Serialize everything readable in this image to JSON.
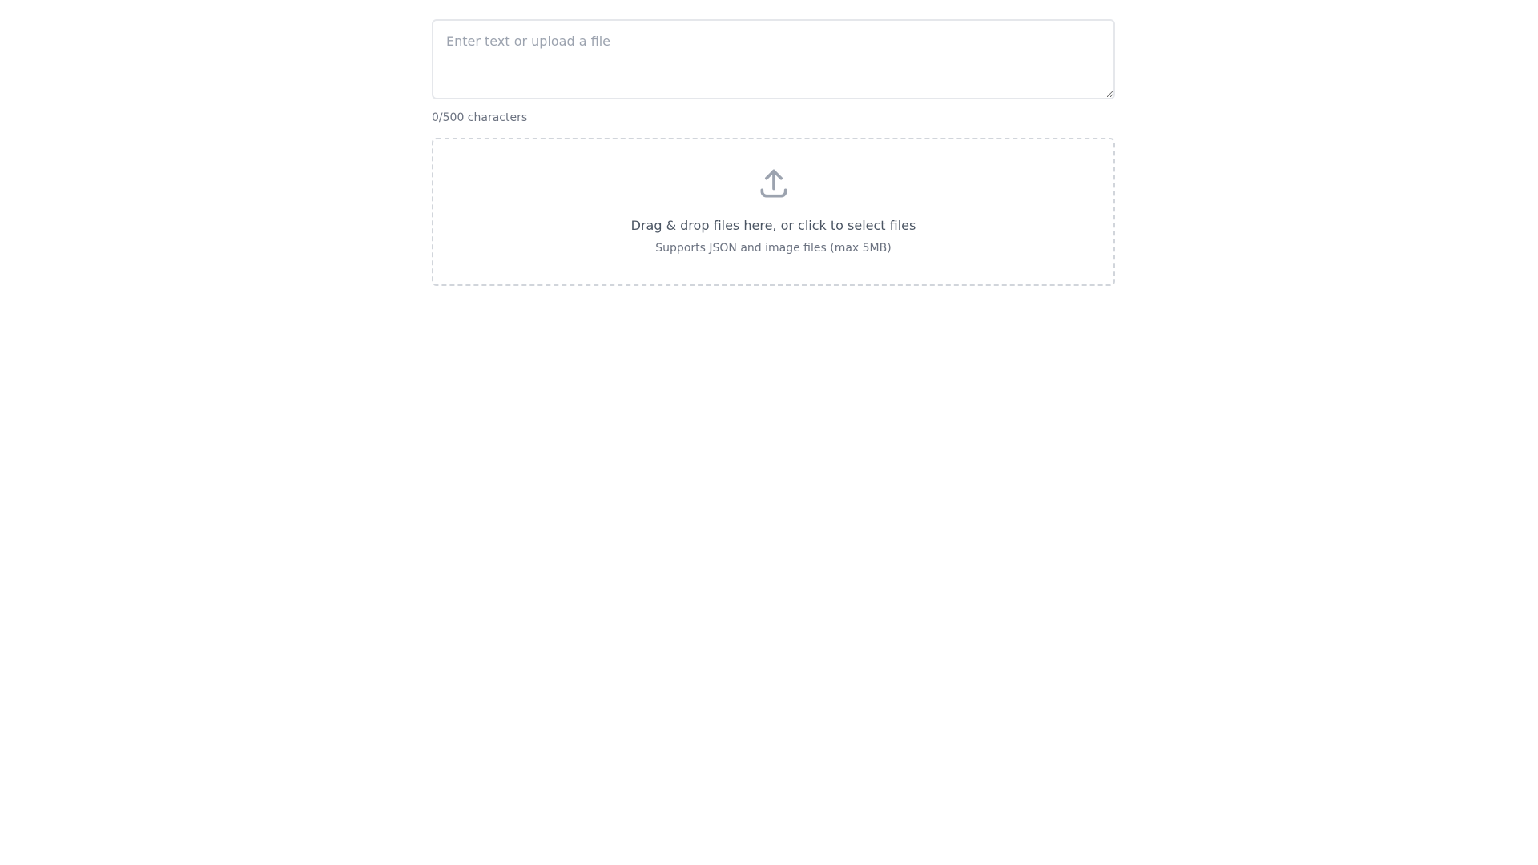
{
  "text_input": {
    "value": "",
    "placeholder": "Enter text or upload a file"
  },
  "char_count": "0/500 characters",
  "dropzone": {
    "icon": "upload-icon",
    "title": "Drag & drop files here, or click to select files",
    "subtitle": "Supports JSON and image files (max 5MB)"
  },
  "colors": {
    "border": "#e5e7eb",
    "dashed_border": "#d1d5db",
    "icon": "#9ca3af",
    "muted_text": "#6b7280",
    "text": "#4b5563"
  }
}
